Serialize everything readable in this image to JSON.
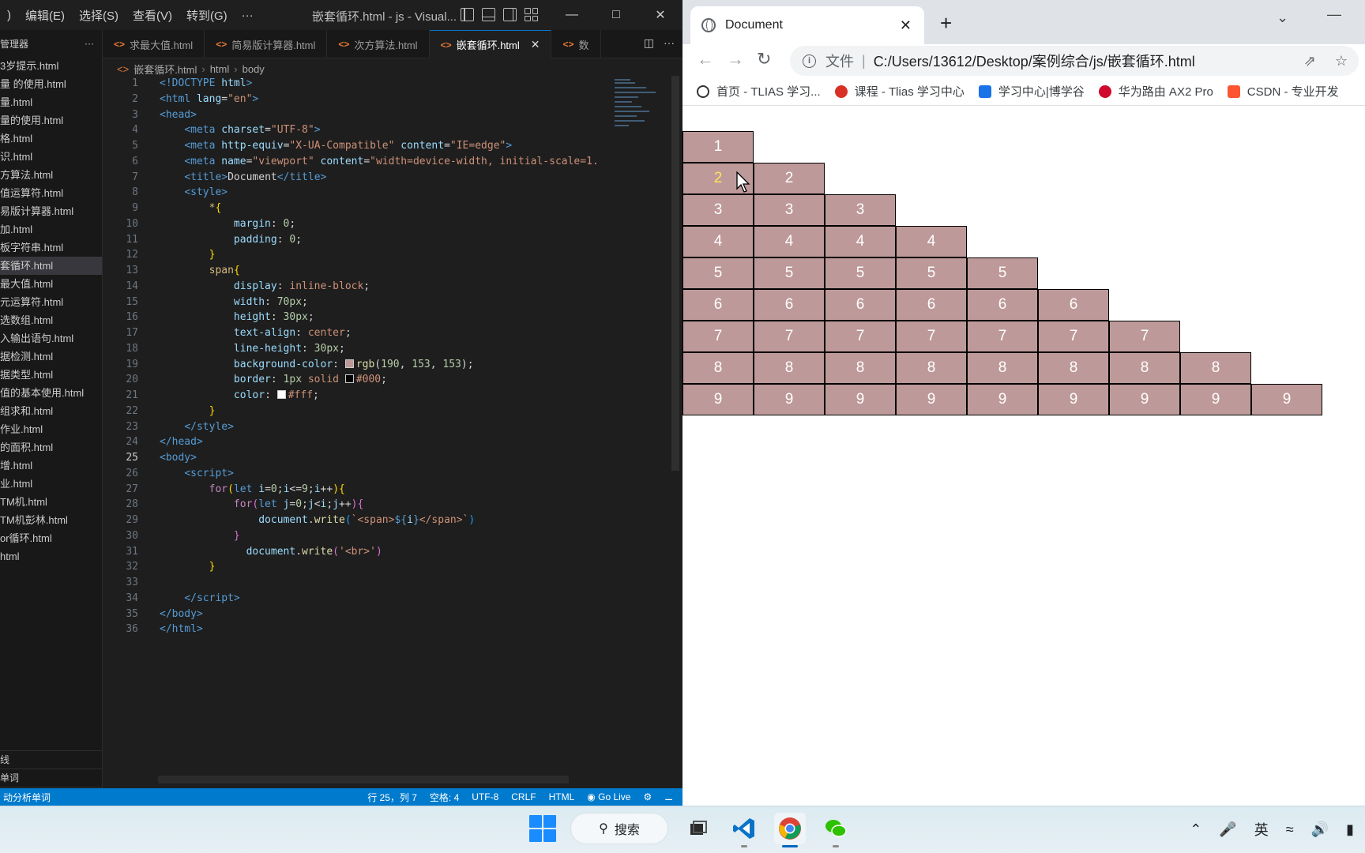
{
  "vscode": {
    "menu": [
      ")",
      "编辑(E)",
      "选择(S)",
      "查看(V)",
      "转到(G)",
      "···"
    ],
    "window_title": "嵌套循环.html - js - Visual...",
    "explorer_title": "管理器",
    "explorer_items": [
      "3岁提示.html",
      "量 的使用.html",
      "量.html",
      "量的使用.html",
      "格.html",
      "识.html",
      "方算法.html",
      "值运算符.html",
      "易版计算器.html",
      "加.html",
      "板字符串.html",
      "套循环.html",
      "最大值.html",
      "元运算符.html",
      "选数组.html",
      "入输出语句.html",
      "据检测.html",
      "据类型.html",
      "值的基本使用.html",
      "组求和.html",
      "作业.html",
      "的面积.html",
      "增.html",
      "业.html",
      "TM机.html",
      "TM机彭林.html",
      "or循环.html",
      "html"
    ],
    "explorer_bottom": [
      "线",
      "单词"
    ],
    "tabs": [
      {
        "label": "求最大值.html"
      },
      {
        "label": "简易版计算器.html"
      },
      {
        "label": "次方算法.html"
      },
      {
        "label": "嵌套循环.html"
      },
      {
        "label": "数"
      }
    ],
    "breadcrumb": [
      "嵌套循环.html",
      "html",
      "body"
    ],
    "status": {
      "left": "动分析单词",
      "position": "行 25，列 7",
      "spaces": "空格: 4",
      "encoding": "UTF-8",
      "eol": "CRLF",
      "language": "HTML",
      "golive": "Go Live"
    }
  },
  "chrome": {
    "tab_title": "Document",
    "url_scheme": "文件",
    "url": "C:/Users/13612/Desktop/案例综合/js/嵌套循环.html",
    "bookmarks": [
      {
        "label": "首页 - TLIAS 学习...",
        "color": "#333333"
      },
      {
        "label": "课程 - Tlias 学习中心",
        "color": "#d93025"
      },
      {
        "label": "学习中心|博学谷",
        "color": "#1a73e8"
      },
      {
        "label": "华为路由 AX2 Pro",
        "color": "#cf0a2c"
      },
      {
        "label": "CSDN - 专业开发",
        "color": "#fc5531"
      }
    ],
    "triangle_rows": 9,
    "cell_color": "rgb(190,153,153)"
  },
  "taskbar": {
    "search_label": "搜索",
    "tray_lang": "英"
  }
}
